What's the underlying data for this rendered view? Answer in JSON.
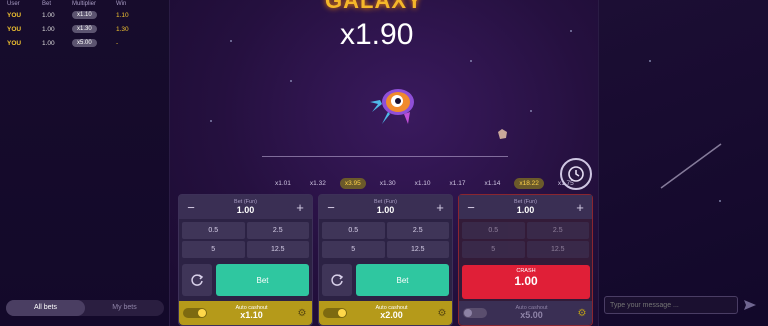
{
  "left_panel": {
    "headers": [
      "User",
      "Bet",
      "Multiplier",
      "Win"
    ],
    "rows": [
      {
        "user": "YOU",
        "bet": "1.00",
        "multiplier": "x1.10",
        "win": "1.10"
      },
      {
        "user": "YOU",
        "bet": "1.00",
        "multiplier": "x1.30",
        "win": "1.30"
      },
      {
        "user": "YOU",
        "bet": "1.00",
        "multiplier": "x5.00",
        "win": "-"
      }
    ],
    "tabs": [
      "All bets",
      "My bets"
    ]
  },
  "game": {
    "title": "GALAXY",
    "multiplier": "x1.90",
    "history": [
      "x1.01",
      "x1.32",
      "x3.95",
      "x1.30",
      "x1.10",
      "x1.17",
      "x1.14",
      "x18.22",
      "x1.75"
    ]
  },
  "panels": [
    {
      "bet_label": "Bet (Fun)",
      "bet_value": "1.00",
      "quick": [
        "0.5",
        "2.5",
        "5",
        "12.5"
      ],
      "action": "Bet",
      "auto_label": "Auto cashout",
      "auto_value": "x1.10"
    },
    {
      "bet_label": "Bet (Fun)",
      "bet_value": "1.00",
      "quick": [
        "0.5",
        "2.5",
        "5",
        "12.5"
      ],
      "action": "Bet",
      "auto_label": "Auto cashout",
      "auto_value": "x2.00"
    },
    {
      "bet_label": "Bet (Fun)",
      "bet_value": "1.00",
      "quick": [
        "0.5",
        "2.5",
        "5",
        "12.5"
      ],
      "crash_label": "CRASH",
      "crash_value": "1.00",
      "auto_label": "Auto cashout",
      "auto_value": "x5.00"
    }
  ],
  "chat": {
    "placeholder": "Type your message ..."
  },
  "colors": {
    "bet_button": "#2fc7a0",
    "crash_button": "#e01f37",
    "autocashout_active": "#b59a1a",
    "accent_yellow": "#f0c230"
  }
}
